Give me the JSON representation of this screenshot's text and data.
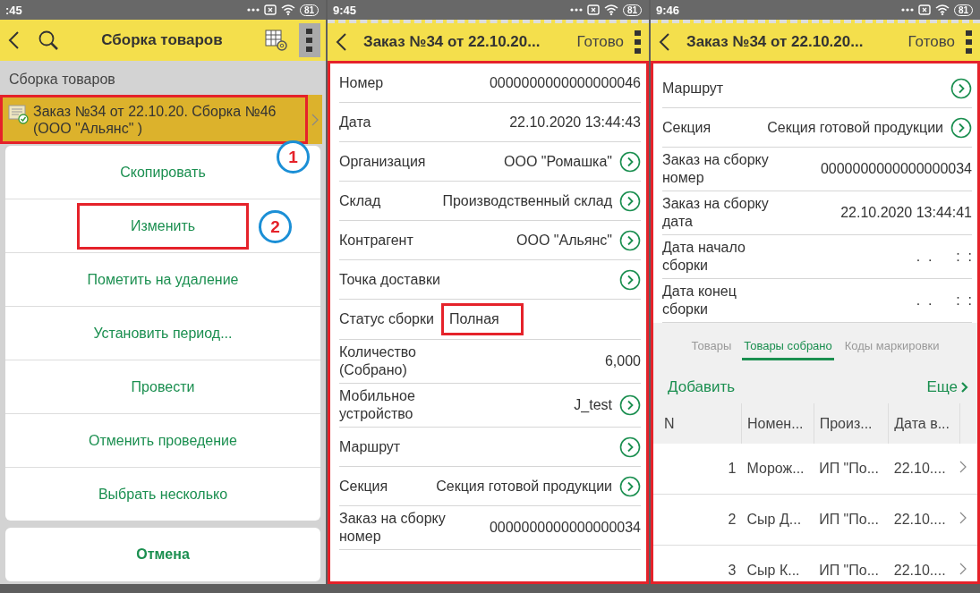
{
  "screen_1": {
    "status_time": ":45",
    "battery": "81",
    "title": "Сборка товаров",
    "section_title": "Сборка товаров",
    "list_items": [
      {
        "text": "Заказ №34 от 22.10.20. Сборка №46 (ООО \"Альянс\" )",
        "selected": true,
        "outlined": true
      }
    ],
    "actions": [
      {
        "label": "Скопировать",
        "outlined": false,
        "callout": "1"
      },
      {
        "label": "Изменить",
        "outlined": true,
        "callout": "2"
      },
      {
        "label": "Пометить на удаление",
        "outlined": false
      },
      {
        "label": "Установить период...",
        "outlined": false
      },
      {
        "label": "Провести",
        "outlined": false
      },
      {
        "label": "Отменить проведение",
        "outlined": false
      },
      {
        "label": "Выбрать несколько",
        "outlined": false
      }
    ],
    "cancel": "Отмена"
  },
  "screen_2": {
    "status_time": "9:45",
    "battery": "81",
    "title": "Заказ №34 от 22.10.20...",
    "done": "Готово",
    "outlined": true,
    "fields": [
      {
        "label": "Номер",
        "value": "0000000000000000046",
        "link": false,
        "boxed": false
      },
      {
        "label": "Дата",
        "value": "22.10.2020 13:44:43",
        "link": false,
        "boxed": false
      },
      {
        "label": "Организация",
        "value": "ООО \"Ромашка\"",
        "link": true,
        "boxed": false
      },
      {
        "label": "Склад",
        "value": "Производственный склад",
        "link": true,
        "boxed": false
      },
      {
        "label": "Контрагент",
        "value": "ООО \"Альянс\"",
        "link": true,
        "boxed": false
      },
      {
        "label": "Точка доставки",
        "link": true
      },
      {
        "label": "Статус сборки",
        "value": "Полная",
        "link": false,
        "boxed": true
      },
      {
        "label": "Количество (Собрано)",
        "value": "6,000",
        "link": false,
        "boxed": false
      },
      {
        "label": "Мобильное устройство",
        "value": "J_test",
        "link": true,
        "boxed": false
      },
      {
        "label": "Маршрут",
        "link": true
      },
      {
        "label": "Секция",
        "value": "Секция готовой продукции",
        "link": true,
        "boxed": false
      },
      {
        "label": "Заказ на сборку номер",
        "value": "0000000000000000034",
        "link": false,
        "boxed": false
      }
    ]
  },
  "screen_3": {
    "status_time": "9:46",
    "battery": "81",
    "title": "Заказ №34 от 22.10.20...",
    "done": "Готово",
    "outlined": true,
    "fields": [
      {
        "label": "Маршрут",
        "link": true
      },
      {
        "label": "Секция",
        "value": "Секция готовой продукции",
        "link": true,
        "boxed": false
      },
      {
        "label": "Заказ на сборку номер",
        "value": "0000000000000000034",
        "link": false,
        "boxed": false
      },
      {
        "label": "Заказ на сборку дата",
        "value": "22.10.2020 13:44:41",
        "link": false,
        "boxed": false
      },
      {
        "label": "Дата начало сборки",
        "value": ".  .      :  :",
        "link": false,
        "boxed": false
      },
      {
        "label": "Дата конец сборки",
        "value": ".  .      :  :",
        "link": false,
        "boxed": false
      }
    ],
    "tabs": [
      {
        "label": "Товары",
        "selected": false
      },
      {
        "label": "Товары собрано",
        "selected": true
      },
      {
        "label": "Коды маркировки",
        "selected": false
      }
    ],
    "add": "Добавить",
    "more": "Еще",
    "table": {
      "columns": [
        "N",
        "Номен...",
        "Произ...",
        "Дата в..."
      ],
      "rows": [
        [
          "1",
          "Морож...",
          "ИП \"По...",
          "22.10...."
        ],
        [
          "2",
          "Сыр Д...",
          "ИП \"По...",
          "22.10...."
        ],
        [
          "3",
          "Сыр К...",
          "ИП \"По...",
          "22.10...."
        ]
      ]
    }
  }
}
